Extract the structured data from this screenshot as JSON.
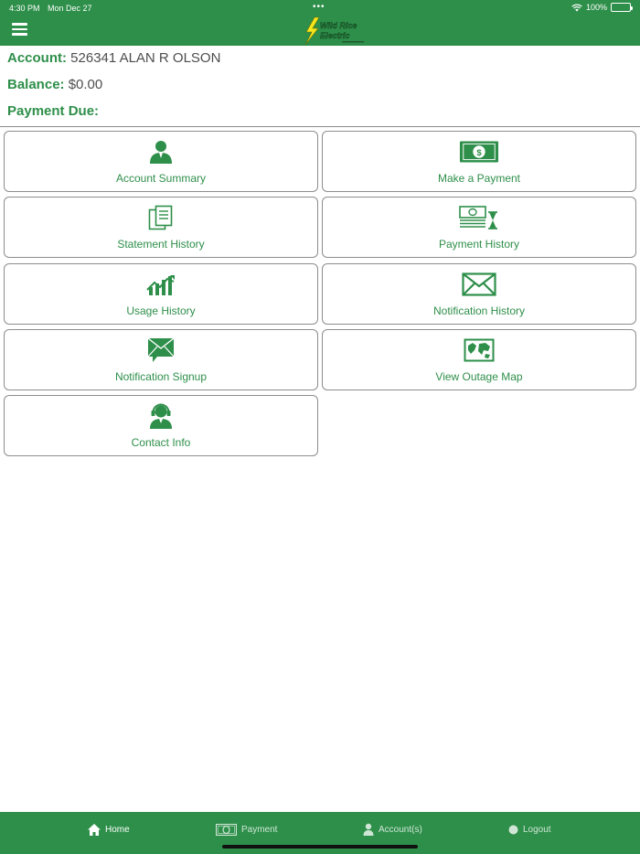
{
  "status_bar": {
    "time": "4:30 PM",
    "date": "Mon Dec 27",
    "battery": "100%"
  },
  "header": {
    "logo_text": "Wild Rice Electric"
  },
  "account": {
    "account_label": "Account:",
    "account_value": "526341 ALAN R OLSON",
    "balance_label": "Balance:",
    "balance_value": "$0.00",
    "payment_due_label": "Payment Due:",
    "payment_due_value": ""
  },
  "tiles": [
    {
      "label": "Account Summary",
      "icon": "person-icon"
    },
    {
      "label": "Make a Payment",
      "icon": "cash-icon"
    },
    {
      "label": "Statement History",
      "icon": "documents-icon"
    },
    {
      "label": "Payment History",
      "icon": "cash-stack-hourglass-icon"
    },
    {
      "label": "Usage History",
      "icon": "chart-trend-icon"
    },
    {
      "label": "Notification History",
      "icon": "envelope-icon"
    },
    {
      "label": "Notification Signup",
      "icon": "envelope-chat-icon"
    },
    {
      "label": "View Outage Map",
      "icon": "map-icon"
    },
    {
      "label": "Contact Info",
      "icon": "support-agent-icon"
    }
  ],
  "bottom_nav": [
    {
      "label": "Home",
      "icon": "home-icon",
      "active": true
    },
    {
      "label": "Payment",
      "icon": "cash-icon",
      "active": false
    },
    {
      "label": "Account(s)",
      "icon": "person-icon",
      "active": false
    },
    {
      "label": "Logout",
      "icon": "logout-icon",
      "active": false
    }
  ],
  "colors": {
    "brand_green": "#2e8f4a",
    "text_gray": "#4d4d4d",
    "border_gray": "#8d8d8d"
  }
}
